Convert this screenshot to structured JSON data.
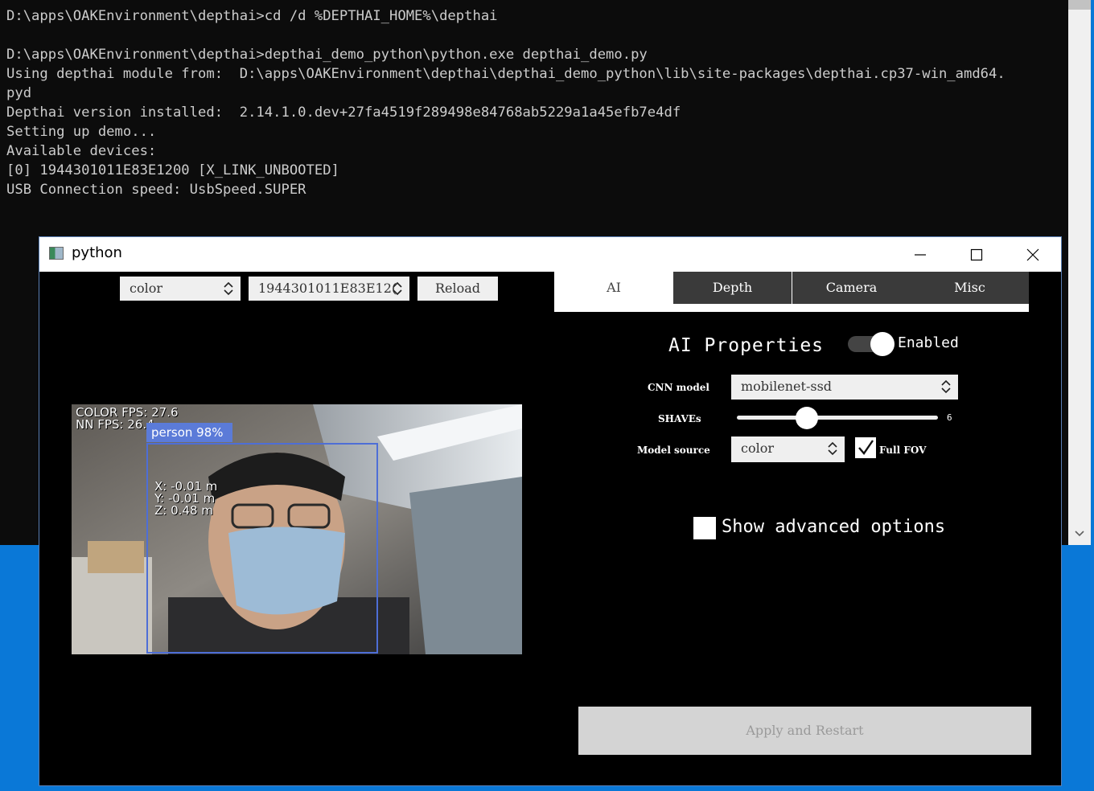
{
  "console": {
    "lines": [
      "D:\\apps\\OAKEnvironment\\depthai>cd /d %DEPTHAI_HOME%\\depthai",
      "",
      "D:\\apps\\OAKEnvironment\\depthai>depthai_demo_python\\python.exe depthai_demo.py",
      "Using depthai module from:  D:\\apps\\OAKEnvironment\\depthai\\depthai_demo_python\\lib\\site-packages\\depthai.cp37-win_amd64.",
      "pyd",
      "Depthai version installed:  2.14.1.0.dev+27fa4519f289498e84768ab5229a1a45efb7e4df",
      "Setting up demo...",
      "Available devices:",
      "[0] 1944301011E83E1200 [X_LINK_UNBOOTED]",
      "USB Connection speed: UsbSpeed.SUPER"
    ],
    "scroll_down_icon": "chevron-down-icon"
  },
  "window": {
    "title": "python",
    "icons": [
      "minimize-icon",
      "maximize-icon",
      "close-icon"
    ]
  },
  "top_controls": {
    "source_select": "color",
    "device_select": "1944301011E83E12(",
    "reload_label": "Reload"
  },
  "video": {
    "color_fps": "COLOR FPS: 27.6",
    "nn_fps": "NN FPS:  26.4",
    "detection_label": "person 98%",
    "x_coord": "X: -0.01  m",
    "y_coord": "Y: -0.01  m",
    "z_coord": "Z: 0.48  m",
    "box_color": "#4e6ed6"
  },
  "tabs": [
    {
      "label": "AI",
      "active": true
    },
    {
      "label": "Depth",
      "active": false
    },
    {
      "label": "Camera",
      "active": false
    },
    {
      "label": "Misc",
      "active": false
    }
  ],
  "ai_panel": {
    "title": "AI Properties",
    "enabled_label": "Enabled",
    "enabled": true,
    "cnn_model_label": "CNN model",
    "cnn_model_value": "mobilenet-ssd",
    "shaves_label": "SHAVEs",
    "shaves_value": "6",
    "model_source_label": "Model source",
    "model_source_value": "color",
    "full_fov_label": "Full FOV",
    "full_fov_checked": true,
    "advanced_label": "Show advanced options",
    "advanced_checked": false
  },
  "apply_label": "Apply and Restart"
}
